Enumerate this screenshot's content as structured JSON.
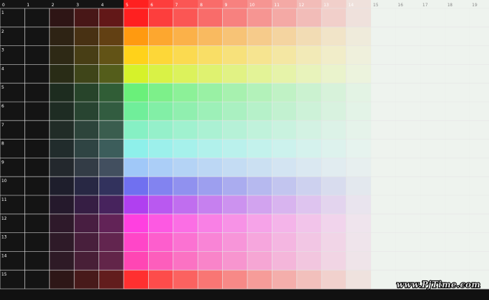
{
  "grid": {
    "columns": 20,
    "rows": 15,
    "column_labels": [
      "0",
      "1",
      "2",
      "3",
      "4",
      "5",
      "6",
      "7",
      "8",
      "9",
      "10",
      "11",
      "12",
      "13",
      "14",
      "15",
      "16",
      "17",
      "18",
      "19"
    ],
    "row_labels": [
      "1",
      "2",
      "3",
      "4",
      "5",
      "6",
      "7",
      "8",
      "9",
      "10",
      "11",
      "12",
      "13",
      "14",
      "15"
    ]
  },
  "colors": {
    "background": "#111111",
    "grid_line": "#e6e6e6",
    "row_hues": [
      "#ff2020",
      "#ff9a10",
      "#ffd21a",
      "#d6f22a",
      "#6af07a",
      "#70ee9a",
      "#86f0c4",
      "#8ef0ea",
      "#a0c8f8",
      "#7070f0",
      "#b040f0",
      "#ff40e0",
      "#ff46c8",
      "#ff46b4",
      "#ff3030"
    ],
    "fade_target": "#eef3ee"
  },
  "watermark": {
    "text": "www.PjTime.com"
  }
}
